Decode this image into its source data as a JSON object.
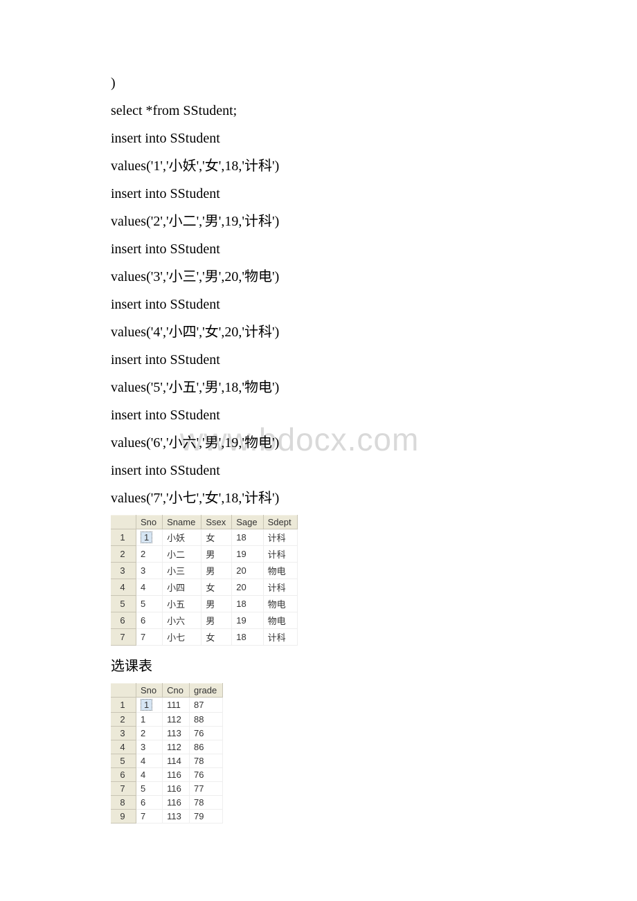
{
  "watermark": "www.bdocx.com",
  "code_lines": [
    ")",
    "select *from SStudent;",
    "insert into SStudent",
    "values('1','小妖','女',18,'计科')",
    "insert into SStudent",
    "values('2','小二','男',19,'计科')",
    "insert into SStudent",
    "values('3','小三','男',20,'物电')",
    "insert into SStudent",
    "values('4','小四','女',20,'计科')",
    "insert into SStudent",
    "values('5','小五','男',18,'物电')",
    "insert into SStudent",
    "values('6','小六','男',19,'物电')",
    "insert into SStudent",
    "values('7','小七','女',18,'计科')"
  ],
  "table1": {
    "headers": [
      "Sno",
      "Sname",
      "Ssex",
      "Sage",
      "Sdept"
    ],
    "rows": [
      {
        "n": "1",
        "Sno": "1",
        "Sname": "小妖",
        "Ssex": "女",
        "Sage": "18",
        "Sdept": "计科"
      },
      {
        "n": "2",
        "Sno": "2",
        "Sname": "小二",
        "Ssex": "男",
        "Sage": "19",
        "Sdept": "计科"
      },
      {
        "n": "3",
        "Sno": "3",
        "Sname": "小三",
        "Ssex": "男",
        "Sage": "20",
        "Sdept": "物电"
      },
      {
        "n": "4",
        "Sno": "4",
        "Sname": "小四",
        "Ssex": "女",
        "Sage": "20",
        "Sdept": "计科"
      },
      {
        "n": "5",
        "Sno": "5",
        "Sname": "小五",
        "Ssex": "男",
        "Sage": "18",
        "Sdept": "物电"
      },
      {
        "n": "6",
        "Sno": "6",
        "Sname": "小六",
        "Ssex": "男",
        "Sage": "19",
        "Sdept": "物电"
      },
      {
        "n": "7",
        "Sno": "7",
        "Sname": "小七",
        "Ssex": "女",
        "Sage": "18",
        "Sdept": "计科"
      }
    ]
  },
  "section_label": "选课表",
  "table2": {
    "headers": [
      "Sno",
      "Cno",
      "grade"
    ],
    "rows": [
      {
        "n": "1",
        "Sno": "1",
        "Cno": "111",
        "grade": "87"
      },
      {
        "n": "2",
        "Sno": "1",
        "Cno": "112",
        "grade": "88"
      },
      {
        "n": "3",
        "Sno": "2",
        "Cno": "113",
        "grade": "76"
      },
      {
        "n": "4",
        "Sno": "3",
        "Cno": "112",
        "grade": "86"
      },
      {
        "n": "5",
        "Sno": "4",
        "Cno": "114",
        "grade": "78"
      },
      {
        "n": "6",
        "Sno": "4",
        "Cno": "116",
        "grade": "76"
      },
      {
        "n": "7",
        "Sno": "5",
        "Cno": "116",
        "grade": "77"
      },
      {
        "n": "8",
        "Sno": "6",
        "Cno": "116",
        "grade": "78"
      },
      {
        "n": "9",
        "Sno": "7",
        "Cno": "113",
        "grade": "79"
      }
    ]
  }
}
